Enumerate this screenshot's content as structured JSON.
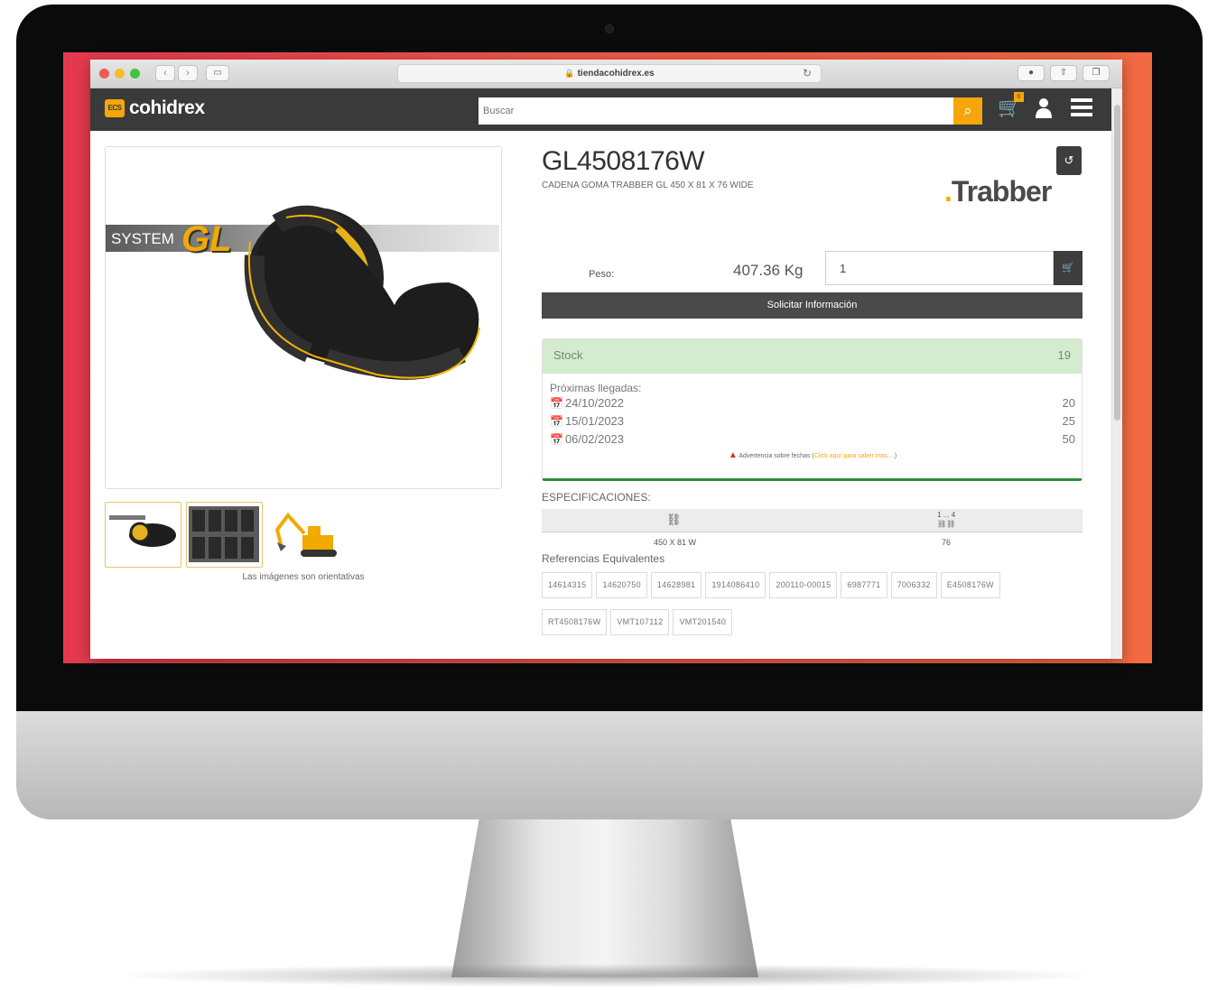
{
  "browser": {
    "url": "tiendacohidrex.es"
  },
  "header": {
    "logo_text": "cohidrex",
    "logo_badge": "ECS",
    "search_placeholder": "Buscar",
    "cart_count": "0"
  },
  "product": {
    "code": "GL4508176W",
    "description": "CADENA GOMA TRABBER GL 450 X 81 X 76 WIDE",
    "brand": "Trabber",
    "weight_label": "Peso:",
    "weight_value": "407.36 Kg",
    "quantity": "1",
    "info_button": "Solicitar Información",
    "image_note": "Las imágenes son orientativas",
    "image_band_text": "SYSTEM",
    "image_band_logo": "GL"
  },
  "stock": {
    "label": "Stock",
    "value": "19",
    "arrivals_title": "Próximas llegadas:",
    "arrivals": [
      {
        "date": "24/10/2022",
        "qty": "20"
      },
      {
        "date": "15/01/2023",
        "qty": "25"
      },
      {
        "date": "06/02/2023",
        "qty": "50"
      }
    ],
    "warning_text": "Advertencia sobre fechas (",
    "warning_link": "Click aquí para saber mas ...",
    "warning_close": ")"
  },
  "specs": {
    "title": "ESPECIFICACIONES:",
    "items": [
      {
        "icon": "track-dimensions-icon",
        "value": "450 X 81 W"
      },
      {
        "icon": "links-count-icon",
        "caption": "1 ... 4",
        "value": "76"
      }
    ]
  },
  "references": {
    "title": "Referencias Equivalentes",
    "items": [
      "14614315",
      "14620750",
      "14628981",
      "1914086410",
      "200110-00015",
      "6987771",
      "7006332",
      "E4508176W",
      "RT4508176W",
      "VMT107112",
      "VMT201540"
    ]
  },
  "colors": {
    "accent": "#f5a60b",
    "header_bg": "#3a3a3a",
    "stock_bg": "#d5ebcf",
    "stock_border": "#2d8f3a"
  }
}
